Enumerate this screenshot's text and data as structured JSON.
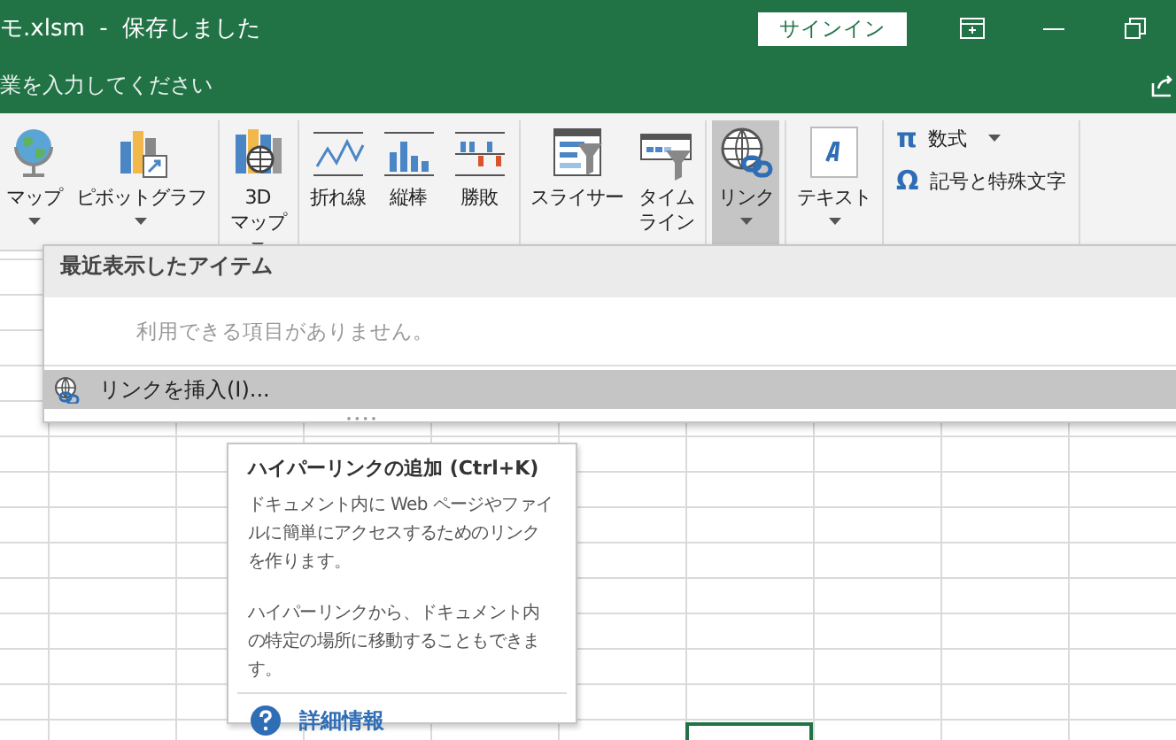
{
  "window": {
    "title": "モ.xlsm  -  保存しました",
    "sign_in": "サインイン"
  },
  "tell_me": {
    "placeholder": "業を入力してください"
  },
  "ribbon": {
    "groups": [
      {
        "buttons": [
          {
            "kind": "globe",
            "label_lines": [
              "マップ"
            ],
            "dropdown": true,
            "pressed": false
          },
          {
            "kind": "pivot",
            "label_lines": [
              "ピボットグラフ"
            ],
            "dropdown": true,
            "pressed": false
          }
        ]
      },
      {
        "buttons": [
          {
            "kind": "map3d",
            "label_lines": [
              "3D",
              "マップ"
            ],
            "dropdown": true,
            "pressed": false
          }
        ]
      },
      {
        "buttons": [
          {
            "kind": "line",
            "label_lines": [
              "折れ線"
            ],
            "dropdown": false,
            "pressed": false
          },
          {
            "kind": "column",
            "label_lines": [
              "縦棒"
            ],
            "dropdown": false,
            "pressed": false
          },
          {
            "kind": "winloss",
            "label_lines": [
              "勝敗"
            ],
            "dropdown": false,
            "pressed": false
          }
        ]
      },
      {
        "buttons": [
          {
            "kind": "slicer",
            "label_lines": [
              "スライサー"
            ],
            "dropdown": false,
            "pressed": false
          },
          {
            "kind": "timeline",
            "label_lines": [
              "タイム",
              "ライン"
            ],
            "dropdown": false,
            "pressed": false
          }
        ]
      },
      {
        "buttons": [
          {
            "kind": "link",
            "label_lines": [
              "リンク"
            ],
            "dropdown": true,
            "pressed": true
          }
        ]
      },
      {
        "buttons": [
          {
            "kind": "textbox",
            "label_lines": [
              "テキスト"
            ],
            "dropdown": true,
            "pressed": false
          }
        ]
      },
      {
        "small": [
          {
            "symbol": "π",
            "label": "数式",
            "dropdown": true
          },
          {
            "symbol": "Ω",
            "label": "記号と特殊文字",
            "dropdown": false
          }
        ]
      }
    ]
  },
  "link_menu": {
    "header": "最近表示したアイテム",
    "empty_message": "利用できる項目がありません。",
    "items": [
      {
        "label": "リンクを挿入(I)...",
        "selected": true
      }
    ]
  },
  "tooltip": {
    "title": "ハイパーリンクの追加 (Ctrl+K)",
    "paragraphs": [
      "ドキュメント内に Web ページやファイルに簡単にアクセスするためのリンクを作ります。",
      "ハイパーリンクから、ドキュメント内の特定の場所に移動することもできます。"
    ],
    "help_link": "詳細情報"
  }
}
